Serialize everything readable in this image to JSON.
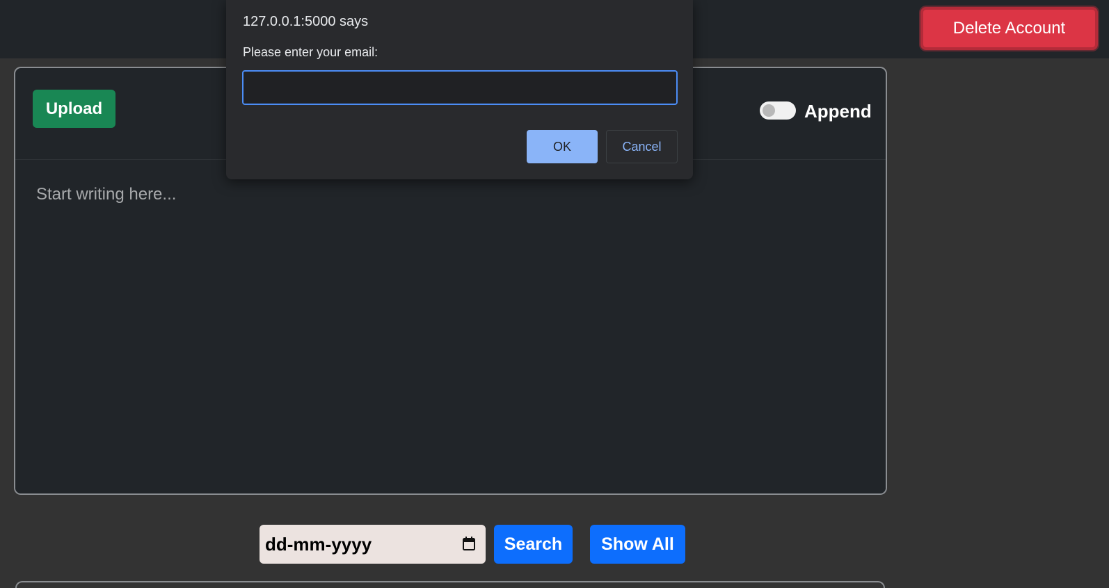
{
  "header": {
    "delete_account_label": "Delete Account"
  },
  "editor": {
    "upload_label": "Upload",
    "append_label": "Append",
    "append_enabled": false,
    "placeholder": "Start writing here..."
  },
  "search_bar": {
    "date_placeholder": "dd-mm-yyyy",
    "search_label": "Search",
    "show_all_label": "Show All"
  },
  "prompt_dialog": {
    "title": "127.0.0.1:5000 says",
    "message": "Please enter your email:",
    "input_value": "",
    "ok_label": "OK",
    "cancel_label": "Cancel"
  },
  "colors": {
    "danger": "#dc3545",
    "success": "#198754",
    "primary": "#0d6efd",
    "dialog_accent": "#8ab4f8"
  },
  "icons": {
    "date_picker": "calendar-icon"
  }
}
